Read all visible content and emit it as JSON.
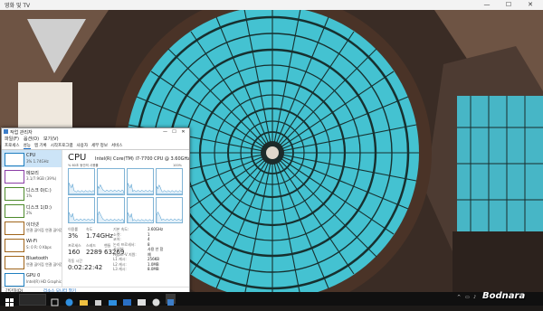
{
  "media_window": {
    "title": "영화 및 TV",
    "controls": {
      "minimize": "—",
      "maximize": "☐",
      "close": "✕"
    }
  },
  "task_manager": {
    "title": "작업 관리자",
    "controls": {
      "minimize": "—",
      "maximize": "☐",
      "close": "✕"
    },
    "menu": [
      "파일(F)",
      "옵션(O)",
      "보기(V)"
    ],
    "tabs": [
      "프로세스",
      "성능",
      "앱 기록",
      "시작프로그램",
      "사용자",
      "세부 정보",
      "서비스"
    ],
    "active_tab": 1,
    "sidebar": [
      {
        "name": "CPU",
        "value": "3% 1.74GHz",
        "color": "#1f7fc0"
      },
      {
        "name": "메모리",
        "value": "3.1/7.9GB (39%)",
        "color": "#8b3fa7"
      },
      {
        "name": "디스크 0(C:)",
        "value": "1%",
        "color": "#4d8a2b"
      },
      {
        "name": "디스크 1(D:)",
        "value": "2%",
        "color": "#4d8a2b"
      },
      {
        "name": "이더넷",
        "value": "연결 끊어짐 연결 끊어짐",
        "color": "#a0651a"
      },
      {
        "name": "Wi-Fi",
        "value": "S: 0 R: 0 Kbps",
        "color": "#a0651a"
      },
      {
        "name": "Bluetooth",
        "value": "연결 끊어짐 연결 끊어짐",
        "color": "#a0651a"
      },
      {
        "name": "GPU 0",
        "value": "Intel(R) HD Graphics",
        "color": "#1f7fc0"
      }
    ],
    "cpu": {
      "heading": "CPU",
      "model": "Intel(R) Core(TM) i7-7700 CPU @ 3.60GHz",
      "graph_label": "% 60초 동안의 사용률",
      "graph_max": "100%",
      "stats": {
        "utilization_label": "이용률",
        "utilization": "3%",
        "speed_label": "속도",
        "speed": "1.74GHz",
        "processes_label": "프로세스",
        "processes": "160",
        "threads_label": "스레드",
        "threads": "2289",
        "handles_label": "핸들",
        "handles": "63269",
        "uptime_label": "작동 시간",
        "uptime": "0:02:22:42"
      },
      "details": [
        {
          "k": "기본 속도:",
          "v": "3.60GHz"
        },
        {
          "k": "소켓:",
          "v": "1"
        },
        {
          "k": "코어:",
          "v": "4"
        },
        {
          "k": "논리 프로세서:",
          "v": "8"
        },
        {
          "k": "가상화:",
          "v": "사용 안 함"
        },
        {
          "k": "Hyper-V 지원:",
          "v": "예"
        },
        {
          "k": "L1 캐시:",
          "v": "256KB"
        },
        {
          "k": "L2 캐시:",
          "v": "1.0MB"
        },
        {
          "k": "L3 캐시:",
          "v": "8.0MB"
        }
      ]
    },
    "footer": {
      "less_details": "간단히(D)",
      "resource_monitor": "리소스 모니터 열기"
    }
  },
  "watermark": "Bodnara",
  "colors": {
    "accent": "#0c64c0",
    "glass": "#3cc6d6",
    "iron": "#16302f"
  }
}
